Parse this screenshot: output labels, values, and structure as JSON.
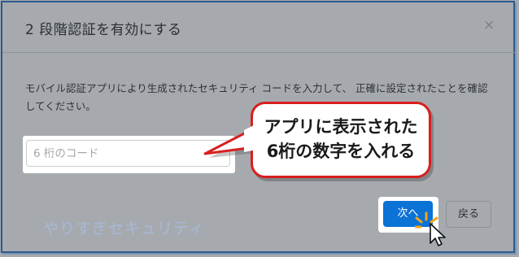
{
  "dialog": {
    "title": "2 段階認証を有効にする",
    "close_glyph": "×",
    "description": "モバイル認証アプリにより生成されたセキュリティ コードを入力して、 正確に設定されたことを確認してください。",
    "code_input": {
      "value": "",
      "placeholder": "6 桁のコード"
    },
    "next_label": "次へ",
    "back_label": "戻る"
  },
  "callout": {
    "line1": "アプリに表示された",
    "line2": "6桁の数字を入れる",
    "border_color": "#d81f1f"
  },
  "watermark": "やりすぎセキュリティ",
  "colors": {
    "primary_button": "#0b72d6",
    "overlay": "#a6aaaf"
  }
}
